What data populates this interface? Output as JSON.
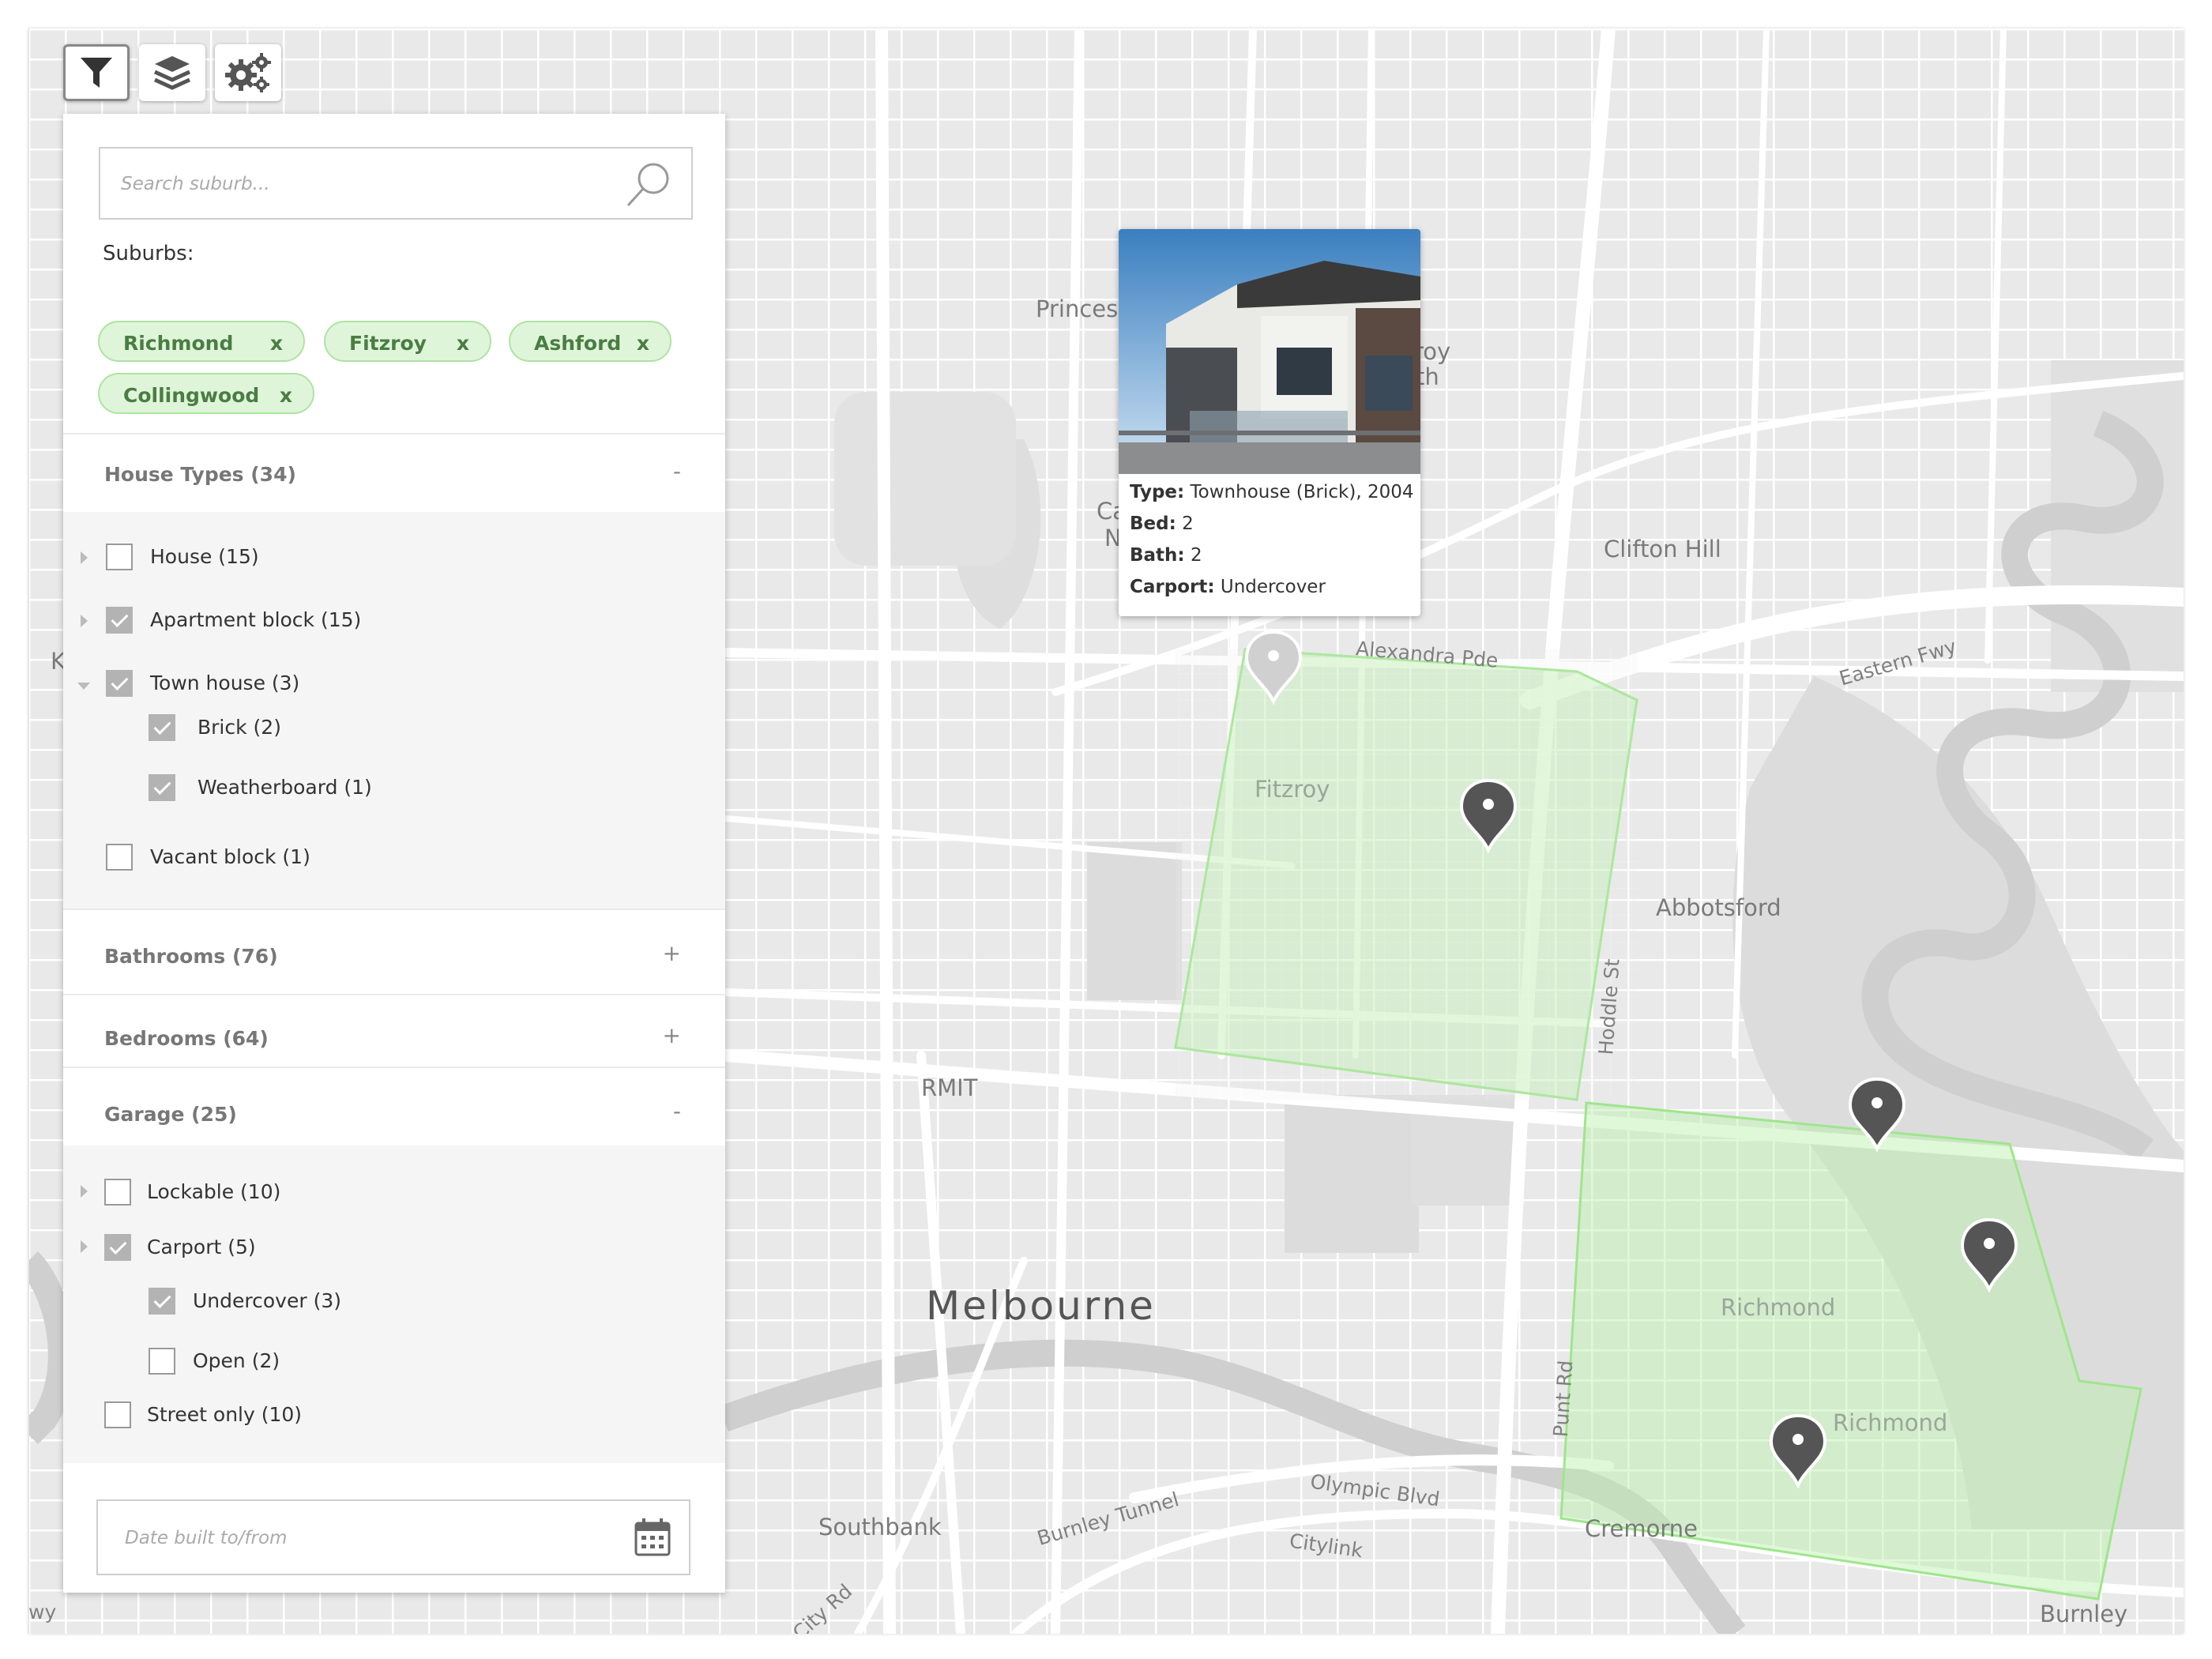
{
  "toolbar": {
    "filter_icon": "filter-icon",
    "layers_icon": "layers-icon",
    "settings_icon": "gears-icon"
  },
  "search": {
    "placeholder": "Search suburb..."
  },
  "suburbs": {
    "label": "Suburbs:",
    "chips": [
      {
        "name": "Richmond",
        "remove": "x"
      },
      {
        "name": "Fitzroy",
        "remove": "x"
      },
      {
        "name": "Ashford",
        "remove": "x"
      },
      {
        "name": "Collingwood",
        "remove": "x"
      }
    ]
  },
  "sections": {
    "house_types": {
      "title": "House Types (34)",
      "toggle": "-",
      "items": [
        {
          "label": "House (15)",
          "checked": false
        },
        {
          "label": "Apartment block (15)",
          "checked": true
        },
        {
          "label": "Town house (3)",
          "checked": true,
          "children": [
            {
              "label": "Brick (2)",
              "checked": true
            },
            {
              "label": "Weatherboard (1)",
              "checked": true
            }
          ]
        },
        {
          "label": "Vacant block (1)",
          "checked": false
        }
      ]
    },
    "bathrooms": {
      "title": "Bathrooms (76)",
      "toggle": "+"
    },
    "bedrooms": {
      "title": "Bedrooms (64)",
      "toggle": "+"
    },
    "garage": {
      "title": "Garage (25)",
      "toggle": "-",
      "items": [
        {
          "label": "Lockable (10)",
          "checked": false
        },
        {
          "label": "Carport (5)",
          "checked": true,
          "children": [
            {
              "label": "Undercover (3)",
              "checked": true
            },
            {
              "label": "Open (2)",
              "checked": false
            }
          ]
        },
        {
          "label": "Street only (10)",
          "checked": false
        }
      ]
    }
  },
  "date_field": {
    "placeholder": "Date built to/from"
  },
  "popup": {
    "type_label": "Type:",
    "type_value": "Townhouse (Brick), 2004",
    "bed_label": "Bed:",
    "bed_value": "2",
    "bath_label": "Bath:",
    "bath_value": "2",
    "carport_label": "Carport:",
    "carport_value": "Undercover"
  },
  "map": {
    "city": "Melbourne",
    "suburbs": [
      "Princes",
      "Clifton Hill",
      "Abbotsford",
      "Southbank",
      "Cremorne",
      "Burnley",
      "RMIT"
    ],
    "fragments": [
      "roy",
      "th",
      "Ca",
      "N",
      "K",
      "wy"
    ],
    "roads": [
      "Alexandra Pde",
      "Eastern Fwy",
      "Hoddle St",
      "Punt Rd",
      "Olympic Blvd",
      "Burnley Tunnel",
      "Citylink",
      "City Rd"
    ],
    "zones": [
      "Fitzroy",
      "Richmond",
      "Richmond"
    ],
    "highlight_color": "#b8f0a8"
  }
}
